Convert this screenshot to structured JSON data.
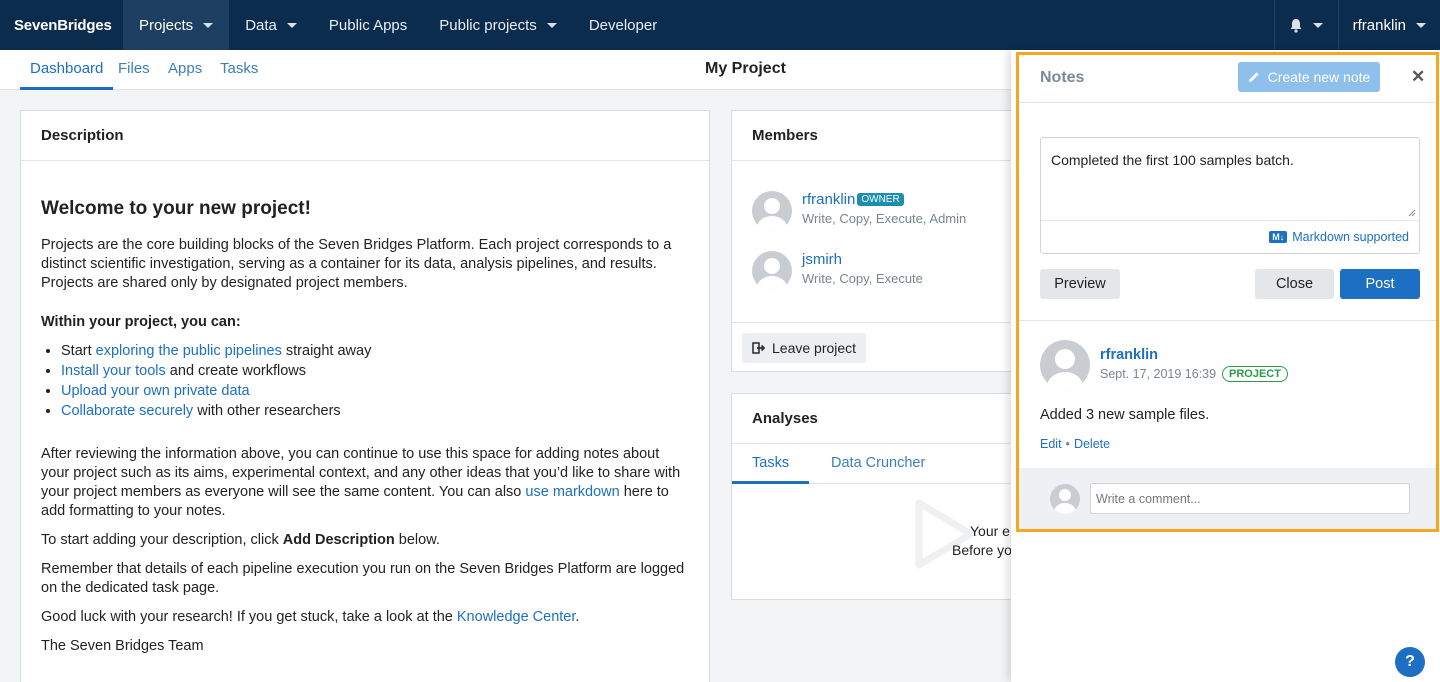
{
  "topnav": {
    "logo": "SevenBridges",
    "items": [
      {
        "label": "Projects",
        "has_caret": true,
        "active": true
      },
      {
        "label": "Data",
        "has_caret": true
      },
      {
        "label": "Public Apps",
        "has_caret": false
      },
      {
        "label": "Public projects",
        "has_caret": true
      },
      {
        "label": "Developer",
        "has_caret": false
      }
    ],
    "bell_icon": "bell-icon",
    "user": "rfranklin"
  },
  "subnav": {
    "tabs": [
      "Dashboard",
      "Files",
      "Apps",
      "Tasks"
    ],
    "active_tab": "Dashboard",
    "project_title": "My Project"
  },
  "description": {
    "header": "Description",
    "heading": "Welcome to your new project!",
    "intro": "Projects are the core building blocks of the Seven Bridges Platform. Each project corresponds to a distinct scientific investigation, serving as a container for its data, analysis pipelines, and results. Projects are shared only by designated project members.",
    "within": "Within your project, you can:",
    "bullets": [
      {
        "pre": "Start ",
        "link": "exploring the public pipelines",
        "post": " straight away"
      },
      {
        "pre": "",
        "link": "Install your tools",
        "post": " and create workflows"
      },
      {
        "pre": "",
        "link": "Upload your own private data",
        "post": ""
      },
      {
        "pre": "",
        "link": "Collaborate securely",
        "post": " with other researchers"
      }
    ],
    "after_pre": "After reviewing the information above, you can continue to use this space for adding notes about your project such as its aims, experimental context, and any other ideas that you’d like to share with your project members as everyone will see the same content. You can also ",
    "after_link": "use markdown",
    "after_post": " here to add formatting to your notes.",
    "add_pre": "To start adding your description, click ",
    "add_bold": "Add Description",
    "add_post": " below.",
    "remember": "Remember that details of each pipeline execution you run on the Seven Bridges Platform are logged on the dedicated task page.",
    "luck_pre": "Good luck with your research! If you get stuck, take a look at the ",
    "luck_link": "Knowledge Center",
    "luck_post": ".",
    "signoff": "The Seven Bridges Team"
  },
  "members": {
    "header": "Members",
    "list": [
      {
        "name": "rfranklin",
        "badge": "OWNER",
        "permissions": "Write, Copy, Execute, Admin"
      },
      {
        "name": "jsmirh",
        "badge": "",
        "permissions": "Write, Copy, Execute"
      }
    ],
    "leave_label": "Leave project"
  },
  "analyses": {
    "header": "Analyses",
    "tabs": [
      "Tasks",
      "Data Cruncher"
    ],
    "active_tab": "Tasks",
    "empty_line1": "Your e",
    "empty_line2": "Before yo"
  },
  "notes": {
    "title": "Notes",
    "create_label": "Create new note",
    "editor_text": "Completed the first 100 samples batch.",
    "markdown_badge": "M↓",
    "markdown_label": "Markdown supported",
    "preview_label": "Preview",
    "close_label": "Close",
    "post_label": "Post",
    "entry": {
      "author": "rfranklin",
      "date": "Sept. 17, 2019 16:39",
      "badge": "PROJECT",
      "body": "Added 3 new sample files.",
      "edit_label": "Edit",
      "delete_label": "Delete"
    },
    "comment_placeholder": "Write a comment..."
  },
  "help_label": "?",
  "colors": {
    "nav_bg": "#0b2c4c",
    "accent": "#1c6fc2",
    "highlight_border": "#f5a623",
    "project_badge": "#2a9a4a"
  }
}
